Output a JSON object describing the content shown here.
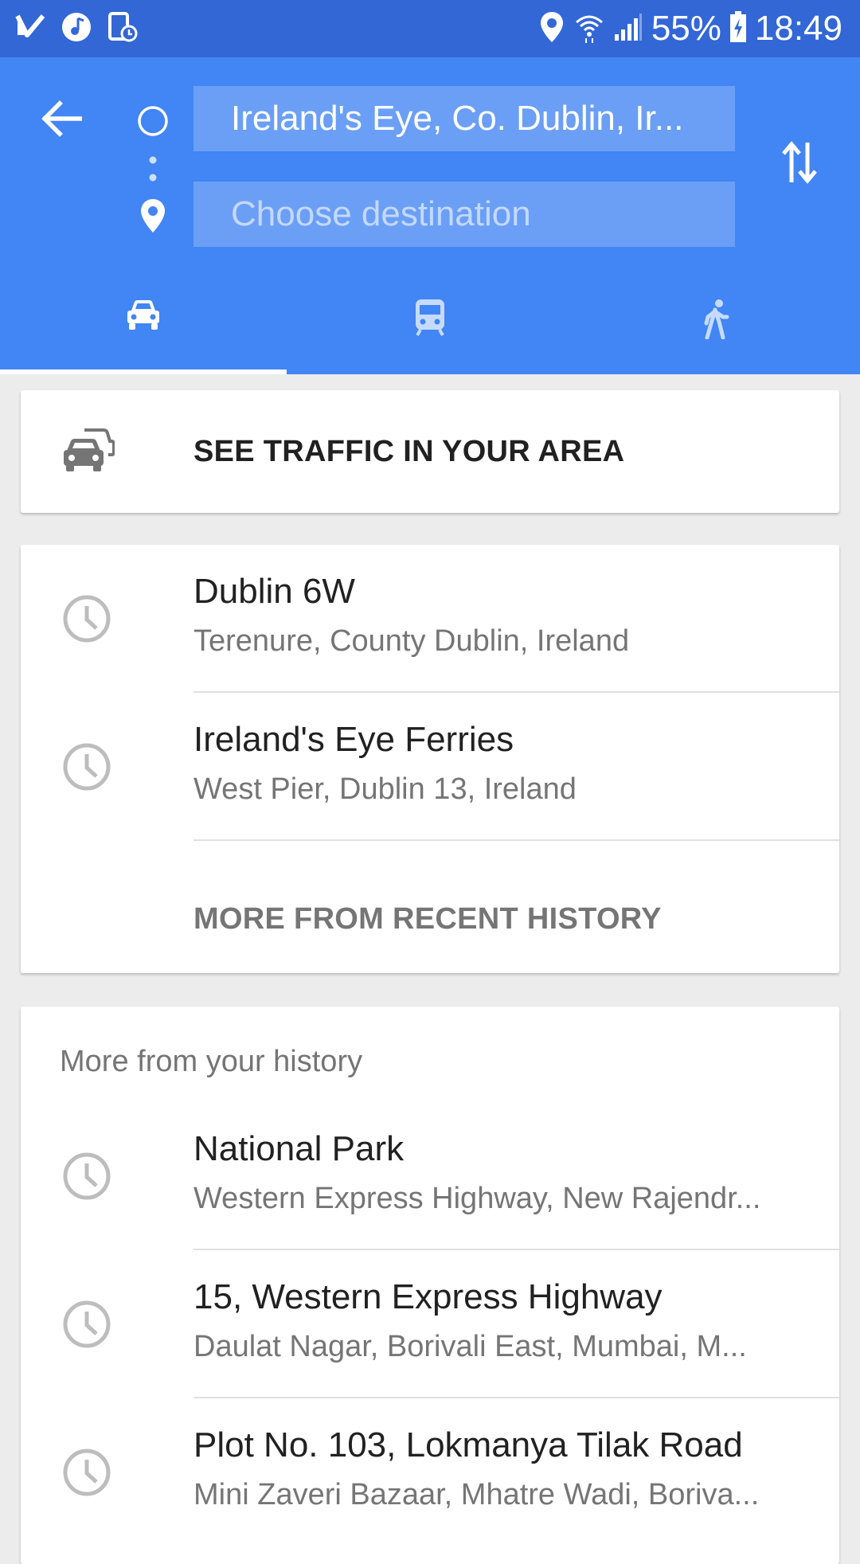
{
  "status_bar": {
    "battery": "55%",
    "time": "18:49",
    "left_icons": [
      "check-icon",
      "music-icon",
      "screen-record-icon"
    ],
    "right_icons": [
      "location-icon",
      "wifi-icon",
      "signal-icon",
      "battery-charging-icon"
    ]
  },
  "directions": {
    "origin": "Ireland's Eye, Co. Dublin, Ir...",
    "destination_placeholder": "Choose destination",
    "modes": [
      "car-icon",
      "transit-icon",
      "walk-icon"
    ],
    "selected_mode": "car-icon"
  },
  "traffic_card": {
    "label": "SEE TRAFFIC IN YOUR AREA",
    "icon": "traffic-icon"
  },
  "recent": {
    "items": [
      {
        "title": "Dublin 6W",
        "subtitle": "Terenure, County Dublin, Ireland"
      },
      {
        "title": "Ireland's Eye Ferries",
        "subtitle": "West Pier, Dublin 13, Ireland"
      }
    ],
    "more_label": "MORE FROM RECENT HISTORY"
  },
  "history": {
    "heading": "More from your history",
    "items": [
      {
        "title": "National Park",
        "subtitle": "Western Express Highway, New Rajendr..."
      },
      {
        "title": "15, Western Express Highway",
        "subtitle": "Daulat Nagar, Borivali East, Mumbai, M..."
      },
      {
        "title": "Plot No. 103, Lokmanya Tilak Road",
        "subtitle": "Mini Zaveri Bazaar, Mhatre Wadi, Boriva..."
      }
    ]
  },
  "colors": {
    "status_bar": "#3367d6",
    "header": "#4285f4",
    "background": "#ececec",
    "icon_grey": "#bdbdbd"
  }
}
